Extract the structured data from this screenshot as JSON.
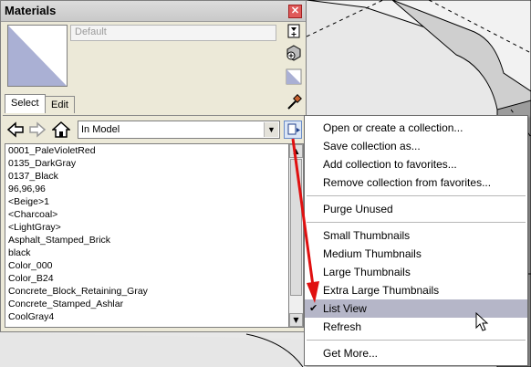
{
  "panel": {
    "title": "Materials",
    "close_icon": "close-icon",
    "material_name": "Default",
    "tabs": [
      {
        "label": "Select"
      },
      {
        "label": "Edit"
      }
    ],
    "collection": "In Model",
    "items": [
      "0001_PaleVioletRed",
      "0135_DarkGray",
      "0137_Black",
      "96,96,96",
      "<Beige>1",
      "<Charcoal>",
      "<LightGray>",
      "Asphalt_Stamped_Brick",
      "black",
      "Color_000",
      "Color_B24",
      "Concrete_Block_Retaining_Gray",
      "Concrete_Stamped_Ashlar",
      "CoolGray4"
    ]
  },
  "menu": {
    "items": [
      {
        "label": "Open or create a collection..."
      },
      {
        "label": "Save collection as..."
      },
      {
        "label": "Add collection to favorites..."
      },
      {
        "label": "Remove collection from favorites..."
      },
      {
        "label": "Purge Unused"
      },
      {
        "label": "Small Thumbnails"
      },
      {
        "label": "Medium Thumbnails"
      },
      {
        "label": "Large Thumbnails"
      },
      {
        "label": "Extra Large Thumbnails"
      },
      {
        "label": "List View",
        "checked": true,
        "checkmark": "✔"
      },
      {
        "label": "Refresh"
      },
      {
        "label": "Get More..."
      }
    ]
  },
  "colors": {
    "highlight": "#b5b6c8",
    "annotation_arrow": "#e01010"
  }
}
